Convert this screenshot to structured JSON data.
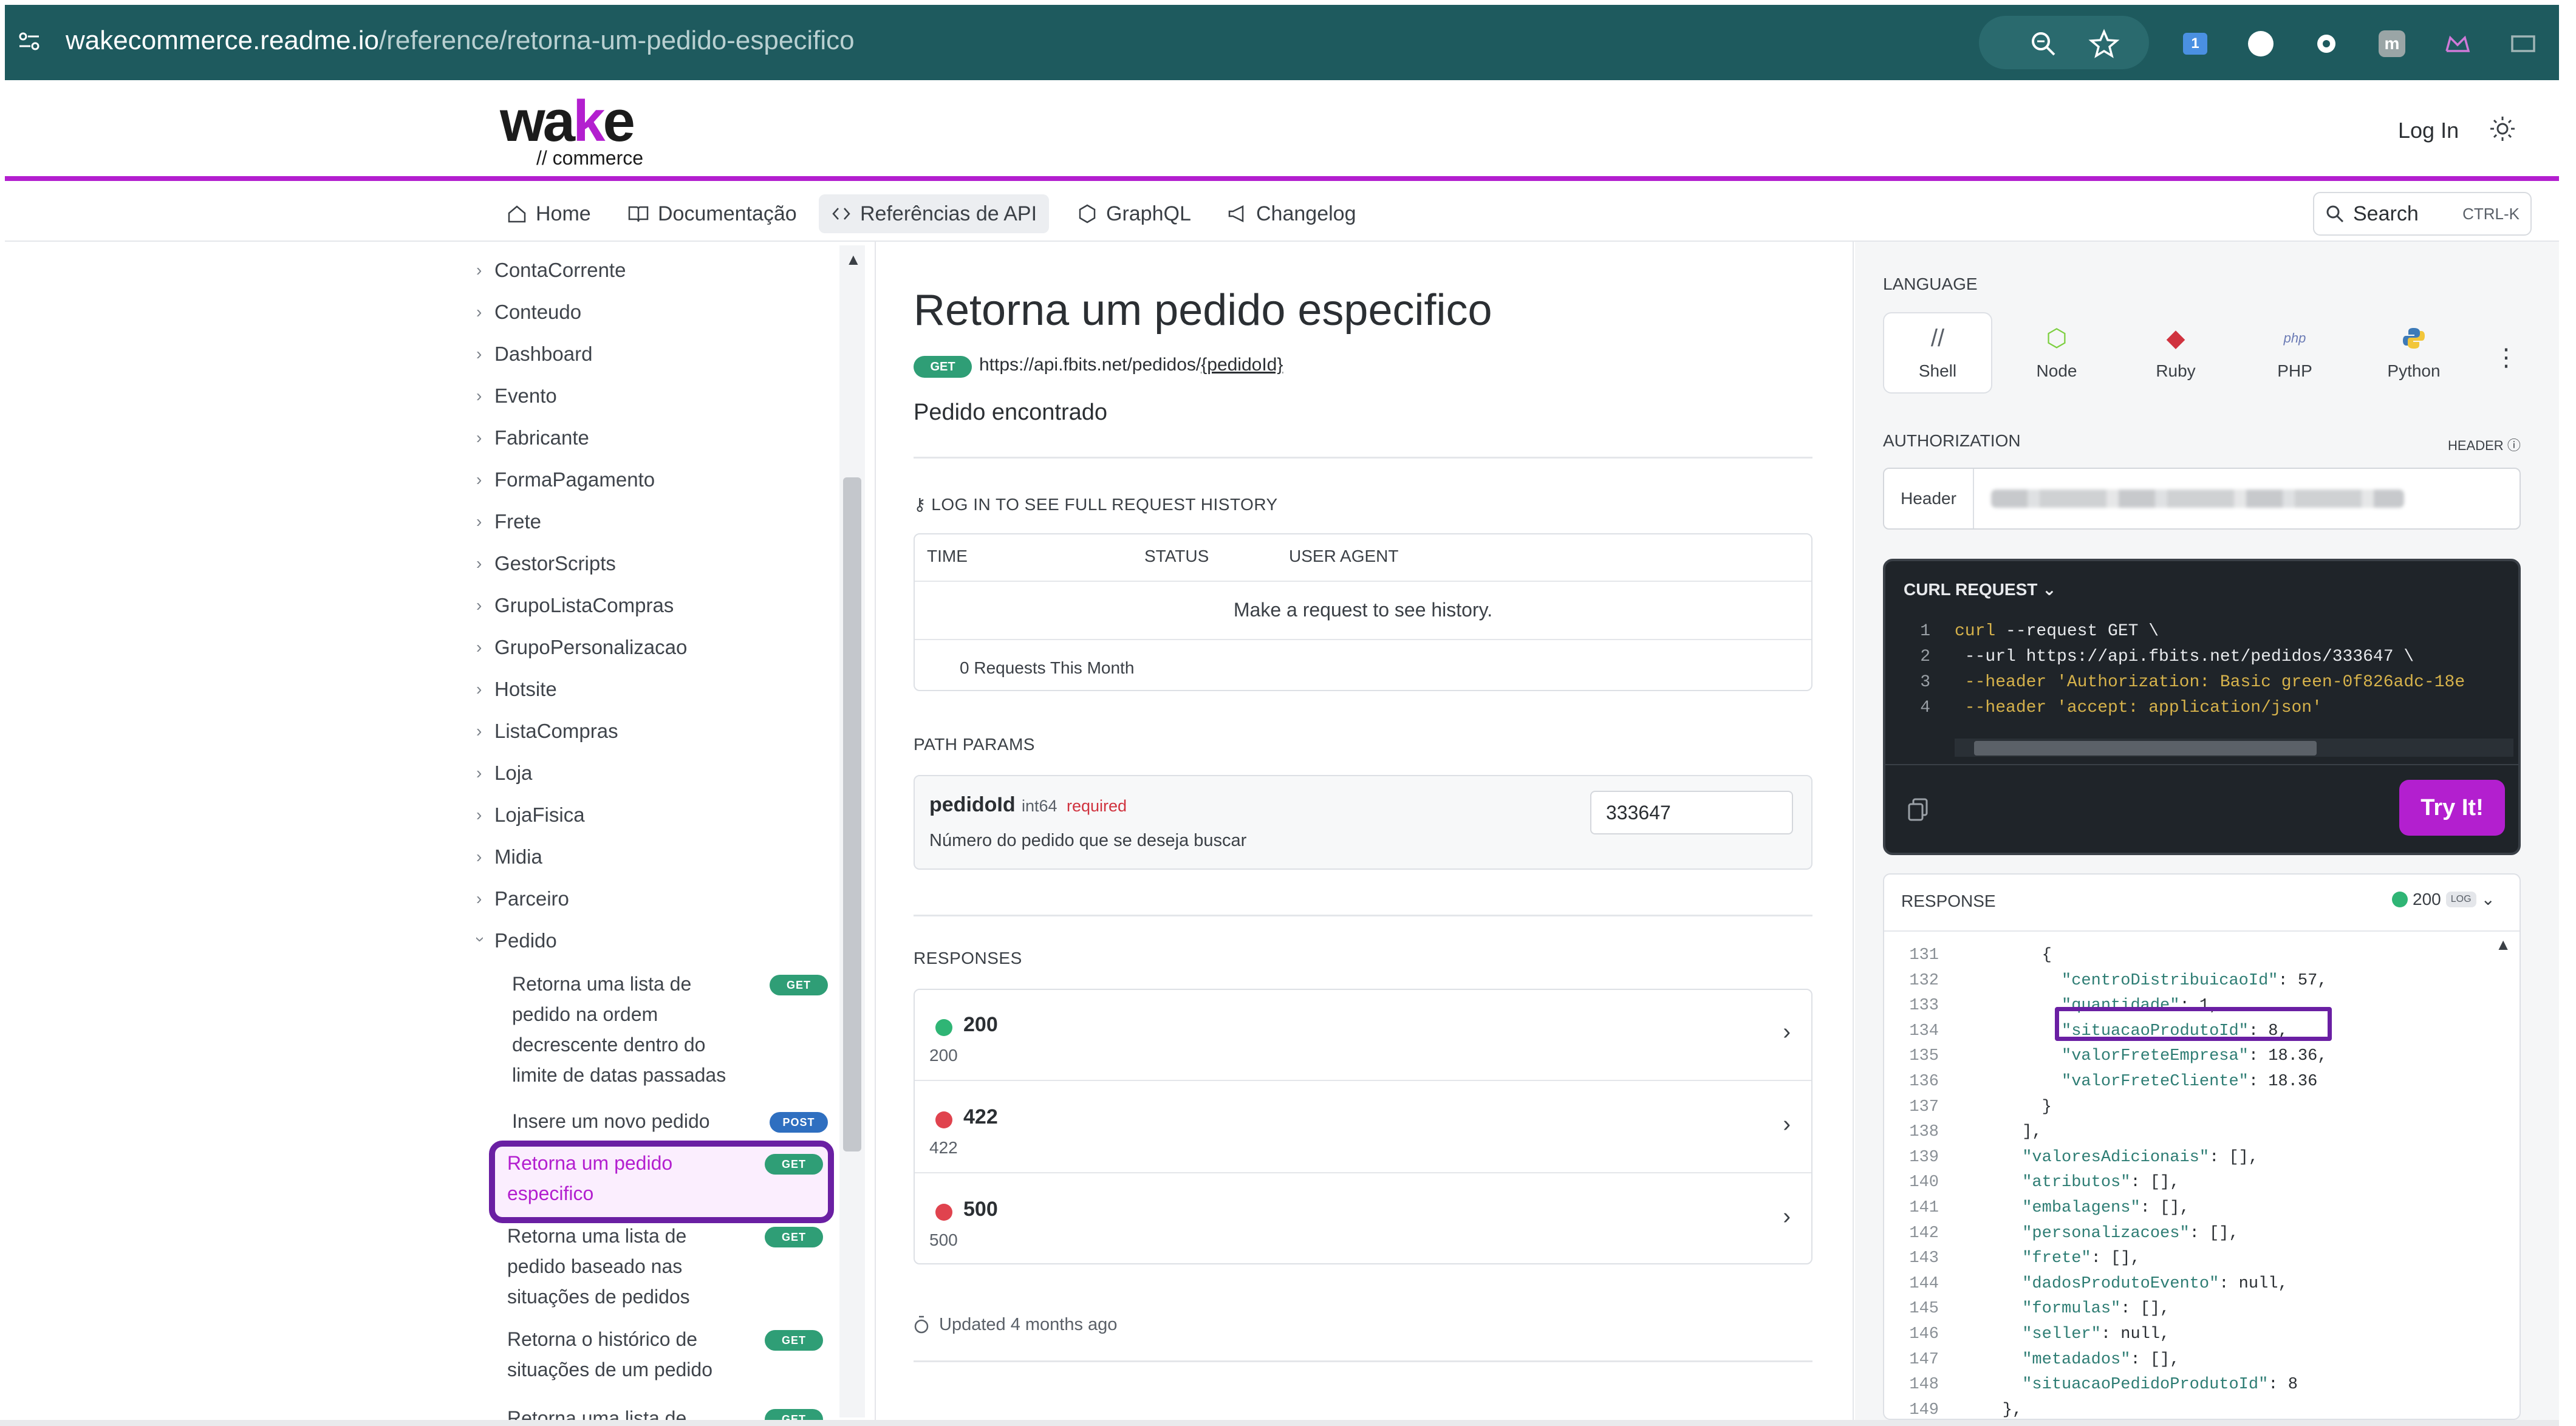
{
  "browser": {
    "url_domain": "wakecommerce.readme.io",
    "url_path": "/reference/retorna-um-pedido-especifico"
  },
  "header": {
    "logo_main": "wake",
    "logo_sub": "// commerce",
    "login": "Log In"
  },
  "nav": {
    "items": [
      {
        "label": "Home",
        "icon": "home-icon"
      },
      {
        "label": "Documentação",
        "icon": "book-icon"
      },
      {
        "label": "Referências de API",
        "icon": "code-icon"
      },
      {
        "label": "GraphQL",
        "icon": "graphql-icon"
      },
      {
        "label": "Changelog",
        "icon": "megaphone-icon"
      }
    ],
    "search_label": "Search",
    "search_shortcut": "CTRL-K"
  },
  "sidebar": {
    "items": [
      "ContaCorrente",
      "Conteudo",
      "Dashboard",
      "Evento",
      "Fabricante",
      "FormaPagamento",
      "Frete",
      "GestorScripts",
      "GrupoListaCompras",
      "GrupoPersonalizacao",
      "Hotsite",
      "ListaCompras",
      "Loja",
      "LojaFisica",
      "Midia",
      "Parceiro",
      "Pedido"
    ],
    "pedido_children": [
      {
        "label": "Retorna uma lista de pedido na ordem decrescente dentro do limite de datas passadas",
        "method": "GET"
      },
      {
        "label": "Insere um novo pedido",
        "method": "POST"
      },
      {
        "label": "Retorna um pedido especifico",
        "method": "GET"
      },
      {
        "label": "Retorna uma lista de pedido baseado nas situações de pedidos",
        "method": "GET"
      },
      {
        "label": "Retorna o histórico de situações de um pedido",
        "method": "GET"
      },
      {
        "label": "Retorna uma lista de",
        "method": "GET"
      }
    ]
  },
  "main": {
    "title": "Retorna um pedido especifico",
    "method": "GET",
    "endpoint_base": "https://api.fbits.net/pedidos/",
    "endpoint_param": "{pedidoId}",
    "description": "Pedido encontrado",
    "log_header": "LOG IN TO SEE FULL REQUEST HISTORY",
    "history": {
      "columns": [
        "TIME",
        "STATUS",
        "USER AGENT"
      ],
      "empty_message": "Make a request to see history.",
      "count": "0 Requests This Month"
    },
    "path_params_label": "PATH PARAMS",
    "param": {
      "name": "pedidoId",
      "type": "int64",
      "required": "required",
      "description": "Número do pedido que se deseja buscar",
      "value": "333647"
    },
    "responses_label": "RESPONSES",
    "responses": [
      {
        "code": "200",
        "sub": "200",
        "color": "#2fb575"
      },
      {
        "code": "422",
        "sub": "422",
        "color": "#e0434e"
      },
      {
        "code": "500",
        "sub": "500",
        "color": "#e0434e"
      }
    ],
    "updated": "Updated 4 months ago"
  },
  "right": {
    "language_label": "LANGUAGE",
    "languages": [
      "Shell",
      "Node",
      "Ruby",
      "PHP",
      "Python"
    ],
    "authorization_label": "AUTHORIZATION",
    "auth_header_tag": "HEADER",
    "auth_field_label": "Header",
    "curl_label": "CURL REQUEST",
    "curl_lines": [
      {
        "n": "1",
        "a": "curl",
        "b": " --request GET \\"
      },
      {
        "n": "2",
        "a": "",
        "b": "     --url https://api.fbits.net/pedidos/333647 \\"
      },
      {
        "n": "3",
        "a": "",
        "b": "     --header 'Authorization: Basic green-0f826adc-18e"
      },
      {
        "n": "4",
        "a": "",
        "b": "     --header 'accept: application/json'"
      }
    ],
    "try_it": "Try It!",
    "response_label": "RESPONSE",
    "response_status": "200",
    "response_tag": "LOG",
    "json_lines": [
      {
        "n": "131",
        "t": "        {"
      },
      {
        "n": "132",
        "t": "          \"centroDistribuicaoId\": 57,"
      },
      {
        "n": "133",
        "t": "          \"quantidade\": 1,"
      },
      {
        "n": "134",
        "t": "          \"situacaoProdutoId\": 8,"
      },
      {
        "n": "135",
        "t": "          \"valorFreteEmpresa\": 18.36,"
      },
      {
        "n": "136",
        "t": "          \"valorFreteCliente\": 18.36"
      },
      {
        "n": "137",
        "t": "        }"
      },
      {
        "n": "138",
        "t": "      ],"
      },
      {
        "n": "139",
        "t": "      \"valoresAdicionais\": [],"
      },
      {
        "n": "140",
        "t": "      \"atributos\": [],"
      },
      {
        "n": "141",
        "t": "      \"embalagens\": [],"
      },
      {
        "n": "142",
        "t": "      \"personalizacoes\": [],"
      },
      {
        "n": "143",
        "t": "      \"frete\": [],"
      },
      {
        "n": "144",
        "t": "      \"dadosProdutoEvento\": null,"
      },
      {
        "n": "145",
        "t": "      \"formulas\": [],"
      },
      {
        "n": "146",
        "t": "      \"seller\": null,"
      },
      {
        "n": "147",
        "t": "      \"metadados\": [],"
      },
      {
        "n": "148",
        "t": "      \"situacaoPedidoProdutoId\": 8"
      },
      {
        "n": "149",
        "t": "    },"
      }
    ]
  },
  "colors": {
    "brand": "#b31fcf",
    "highlight": "#6a1fa3",
    "get": "#2f9e76",
    "post": "#2f6fc0"
  }
}
